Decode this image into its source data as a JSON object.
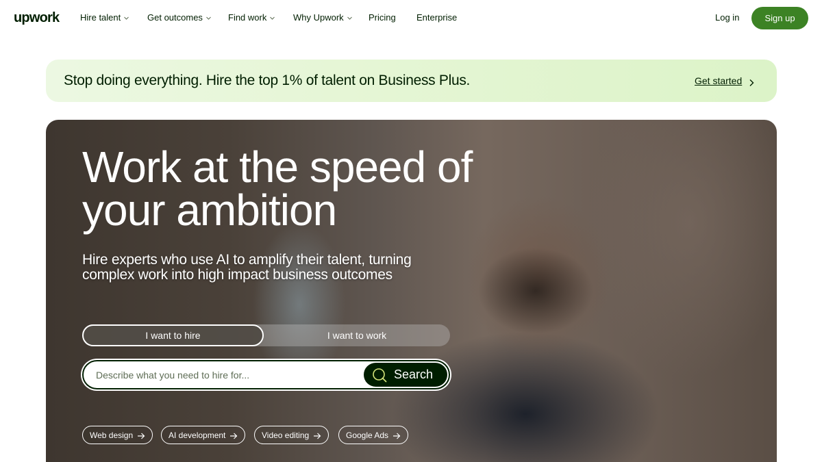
{
  "nav": {
    "logo": "upwork",
    "items": [
      {
        "label": "Hire talent",
        "dropdown": true
      },
      {
        "label": "Get outcomes",
        "dropdown": true
      },
      {
        "label": "Find work",
        "dropdown": true
      },
      {
        "label": "Why Upwork",
        "dropdown": true
      },
      {
        "label": "Pricing",
        "dropdown": false
      },
      {
        "label": "Enterprise",
        "dropdown": false
      }
    ],
    "login": "Log in",
    "signup": "Sign up"
  },
  "promo": {
    "text": "Stop doing everything. Hire the top 1% of talent on Business Plus.",
    "link": "Get started"
  },
  "hero": {
    "title": "Work at the speed of your ambition",
    "subtitle": "Hire experts who use AI to amplify their talent, turning complex work into high impact business outcomes",
    "toggle": {
      "hire": "I want to hire",
      "work": "I want to work",
      "selected": "hire"
    },
    "search": {
      "placeholder": "Describe what you need to hire for...",
      "button": "Search"
    },
    "chips": [
      "Web design",
      "AI development",
      "Video editing",
      "Google Ads"
    ]
  },
  "colors": {
    "brand_green": "#3c8224",
    "text_dark": "#001e00",
    "promo_bg": "#e6f6d6"
  }
}
